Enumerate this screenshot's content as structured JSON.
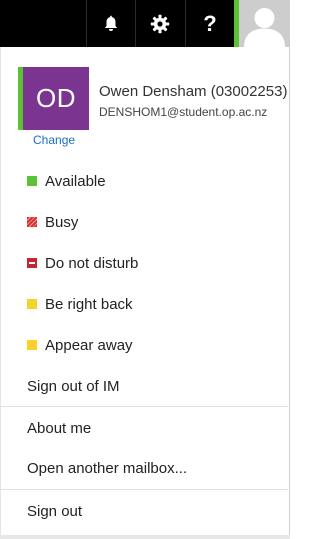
{
  "topbar": {
    "icons": [
      "bell-icon",
      "gear-icon",
      "help-icon"
    ],
    "help_label": "?",
    "presence_color": "#5bc236",
    "avatar_icon": "person-silhouette-icon"
  },
  "profile": {
    "initials": "OD",
    "tile_color": "#7b3590",
    "presence_color": "#5bc236",
    "name": "Owen Densham (03002253)",
    "email": "DENSHOM1@student.op.ac.nz",
    "change_label": "Change",
    "link_color": "#1a6fc9"
  },
  "statuses": [
    {
      "label": "Available",
      "color": "#5bc236"
    },
    {
      "label": "Busy",
      "color": "#d9302c"
    },
    {
      "label": "Do not disturb",
      "color": "#c4262e"
    },
    {
      "label": "Be right back",
      "color": "#f8d22a"
    },
    {
      "label": "Appear away",
      "color": "#f8d22a"
    }
  ],
  "menu": {
    "sign_out_im": "Sign out of IM",
    "about_me": "About me",
    "open_mailbox": "Open another mailbox...",
    "sign_out": "Sign out"
  }
}
